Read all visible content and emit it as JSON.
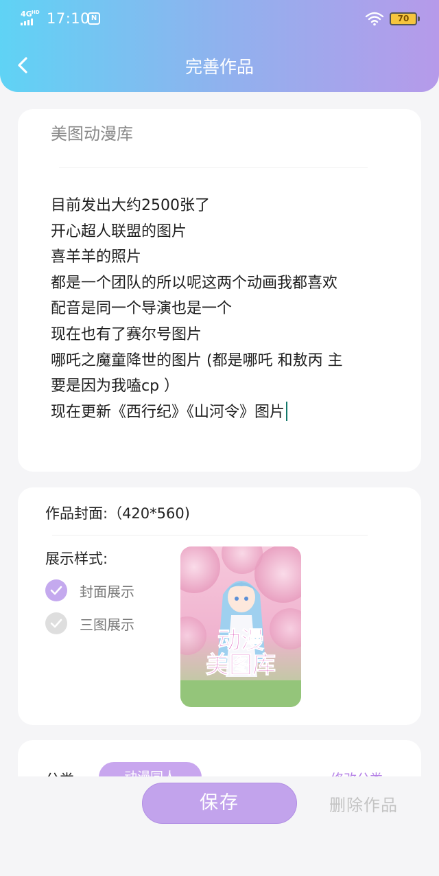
{
  "status_bar": {
    "network": "4G",
    "network_hd": "HD",
    "time": "17:10",
    "battery": "70"
  },
  "header": {
    "title": "完善作品",
    "back_icon": "chevron-left-icon"
  },
  "work": {
    "title": "美图动漫库",
    "description_lines": [
      "目前发出大约2500张了",
      "开心超人联盟的图片",
      "喜羊羊的照片",
      "都是一个团队的所以呢这两个动画我都喜欢",
      "配音是同一个导演也是一个",
      "现在也有了赛尔号图片",
      "哪吒之魔童降世的图片 (都是哪吒 和敖丙 主",
      "要是因为我嗑cp ）",
      "现在更新《西行纪》《山河令》图片"
    ]
  },
  "cover": {
    "label": "作品封面:（420*560)",
    "style_label": "展示样式:",
    "options": [
      {
        "label": "封面展示",
        "checked": true
      },
      {
        "label": "三图展示",
        "checked": false
      }
    ],
    "image_text_line1": "动漫",
    "image_text_line2": "美图库"
  },
  "category": {
    "label": "分类:",
    "tag": "动漫同人",
    "edit_label": "修改分类"
  },
  "actions": {
    "save_label": "保存",
    "delete_label": "删除作品"
  },
  "colors": {
    "header_gradient_start": "#5fd3f5",
    "header_gradient_end": "#b69aea",
    "accent_purple": "#c2a3ec",
    "check_on": "#c4a9ee",
    "cursor": "#14796b"
  }
}
